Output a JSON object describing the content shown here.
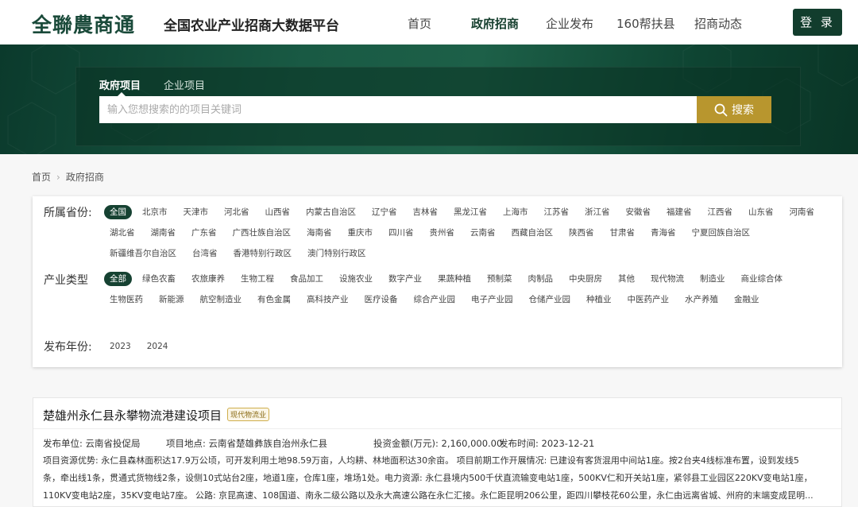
{
  "header": {
    "logo_text": "全聯農商通",
    "site_title": "全国农业产业招商大数据平台",
    "nav": [
      "首页",
      "政府招商",
      "企业发布",
      "160帮扶县",
      "招商动态"
    ],
    "active_nav": "政府招商",
    "login_label": "登 录"
  },
  "search": {
    "tabs": [
      "政府项目",
      "企业项目"
    ],
    "placeholder": "输入您想搜索的的项目关键词",
    "button_label": "搜索"
  },
  "breadcrumb": {
    "home": "首页",
    "current": "政府招商"
  },
  "filters": {
    "province": {
      "label": "所属省份:",
      "options": [
        "全国",
        "北京市",
        "天津市",
        "河北省",
        "山西省",
        "内蒙古自治区",
        "辽宁省",
        "吉林省",
        "黑龙江省",
        "上海市",
        "江苏省",
        "浙江省",
        "安徽省",
        "福建省",
        "江西省",
        "山东省",
        "河南省",
        "湖北省",
        "湖南省",
        "广东省",
        "广西壮族自治区",
        "海南省",
        "重庆市",
        "四川省",
        "贵州省",
        "云南省",
        "西藏自治区",
        "陕西省",
        "甘肃省",
        "青海省",
        "宁夏回族自治区",
        "新疆维吾尔自治区",
        "台湾省",
        "香港特别行政区",
        "澳门特别行政区"
      ]
    },
    "industry": {
      "label": "产业类型",
      "options": [
        "全部",
        "绿色农畜",
        "农旅康养",
        "生物工程",
        "食品加工",
        "设施农业",
        "数字产业",
        "果蔬种植",
        "预制菜",
        "肉制品",
        "中央厨房",
        "其他",
        "现代物流",
        "制造业",
        "商业综合体",
        "生物医药",
        "新能源",
        "航空制造业",
        "有色金属",
        "高科技产业",
        "医疗设备",
        "综合产业园",
        "电子产业园",
        "仓储产业园",
        "种植业",
        "中医药产业",
        "水产养殖",
        "金融业"
      ]
    },
    "year": {
      "label": "发布年份:",
      "options": [
        "2023",
        "2024"
      ]
    }
  },
  "project": {
    "title": "楚雄州永仁县永攀物流港建设项目",
    "tag": "现代物流业",
    "publisher": "发布单位: 云南省投促局",
    "location": "项目地点: 云南省楚雄彝族自治州永仁县",
    "investment": "投资金额(万元): 2,160,000.00",
    "publish_time": "发布时间: 2023-12-21",
    "description_lines": [
      "项目资源优势: 永仁县森林面积达17.9万公顷，可开发利用土地98.59万亩，人均耕、林地面积达30余亩。 项目前期工作开展情况: 已建设有客货混用中间站1座。按2台夹4线标准布置，设到发线5",
      "条，牵出线1条，贯通式货物线2条，设侧10式站台2座，地道1座，仓库1座，堆场1处。电力资源: 永仁县境内500千伏直流输变电站1座，500KV仁和开关站1座，紧邻县工业园区220KV变电站1座，",
      "110KV变电站2座，35KV变电站7座。 公路: 京昆高速、108国道、南永二级公路以及永大高速公路在永仁汇接。永仁距昆明206公里，距四川攀枝花60公里，永仁由远离省城、州府的末端变成昆明..."
    ]
  }
}
